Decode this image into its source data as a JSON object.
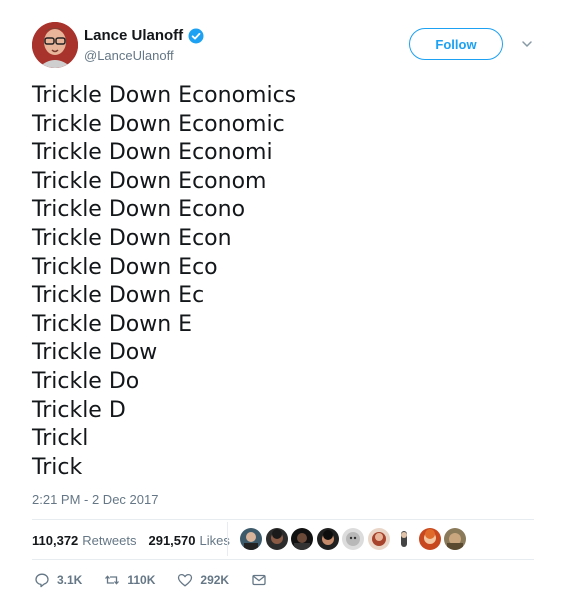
{
  "author": {
    "name": "Lance Ulanoff",
    "handle": "@LanceUlanoff",
    "verified": true
  },
  "follow_label": "Follow",
  "tweet_lines": [
    "Trickle Down Economics",
    "Trickle Down Economic",
    "Trickle Down Economi",
    "Trickle Down Econom",
    "Trickle Down Econo",
    "Trickle Down Econ",
    "Trickle Down Eco",
    "Trickle Down Ec",
    "Trickle Down E",
    "Trickle Dow",
    "Trickle Do",
    "Trickle D",
    "Trickl",
    "Trick"
  ],
  "timestamp": "2:21 PM - 2 Dec 2017",
  "stats": {
    "retweets": {
      "count": "110,372",
      "label": "Retweets"
    },
    "likes": {
      "count": "291,570",
      "label": "Likes"
    }
  },
  "actions": {
    "reply": "3.1K",
    "retweet": "110K",
    "like": "292K"
  },
  "icons": {
    "verified": "verified-badge-icon",
    "caret": "chevron-down-icon",
    "reply": "reply-icon",
    "retweet": "retweet-icon",
    "like": "heart-icon",
    "dm": "envelope-icon"
  },
  "colors": {
    "accent": "#1da1f2",
    "text": "#14171a",
    "muted": "#657786",
    "divider": "#e6ecf0"
  },
  "liker_avatars": [
    "liker-1",
    "liker-2",
    "liker-3",
    "liker-4",
    "liker-5",
    "liker-6",
    "liker-7",
    "liker-8",
    "liker-9"
  ]
}
